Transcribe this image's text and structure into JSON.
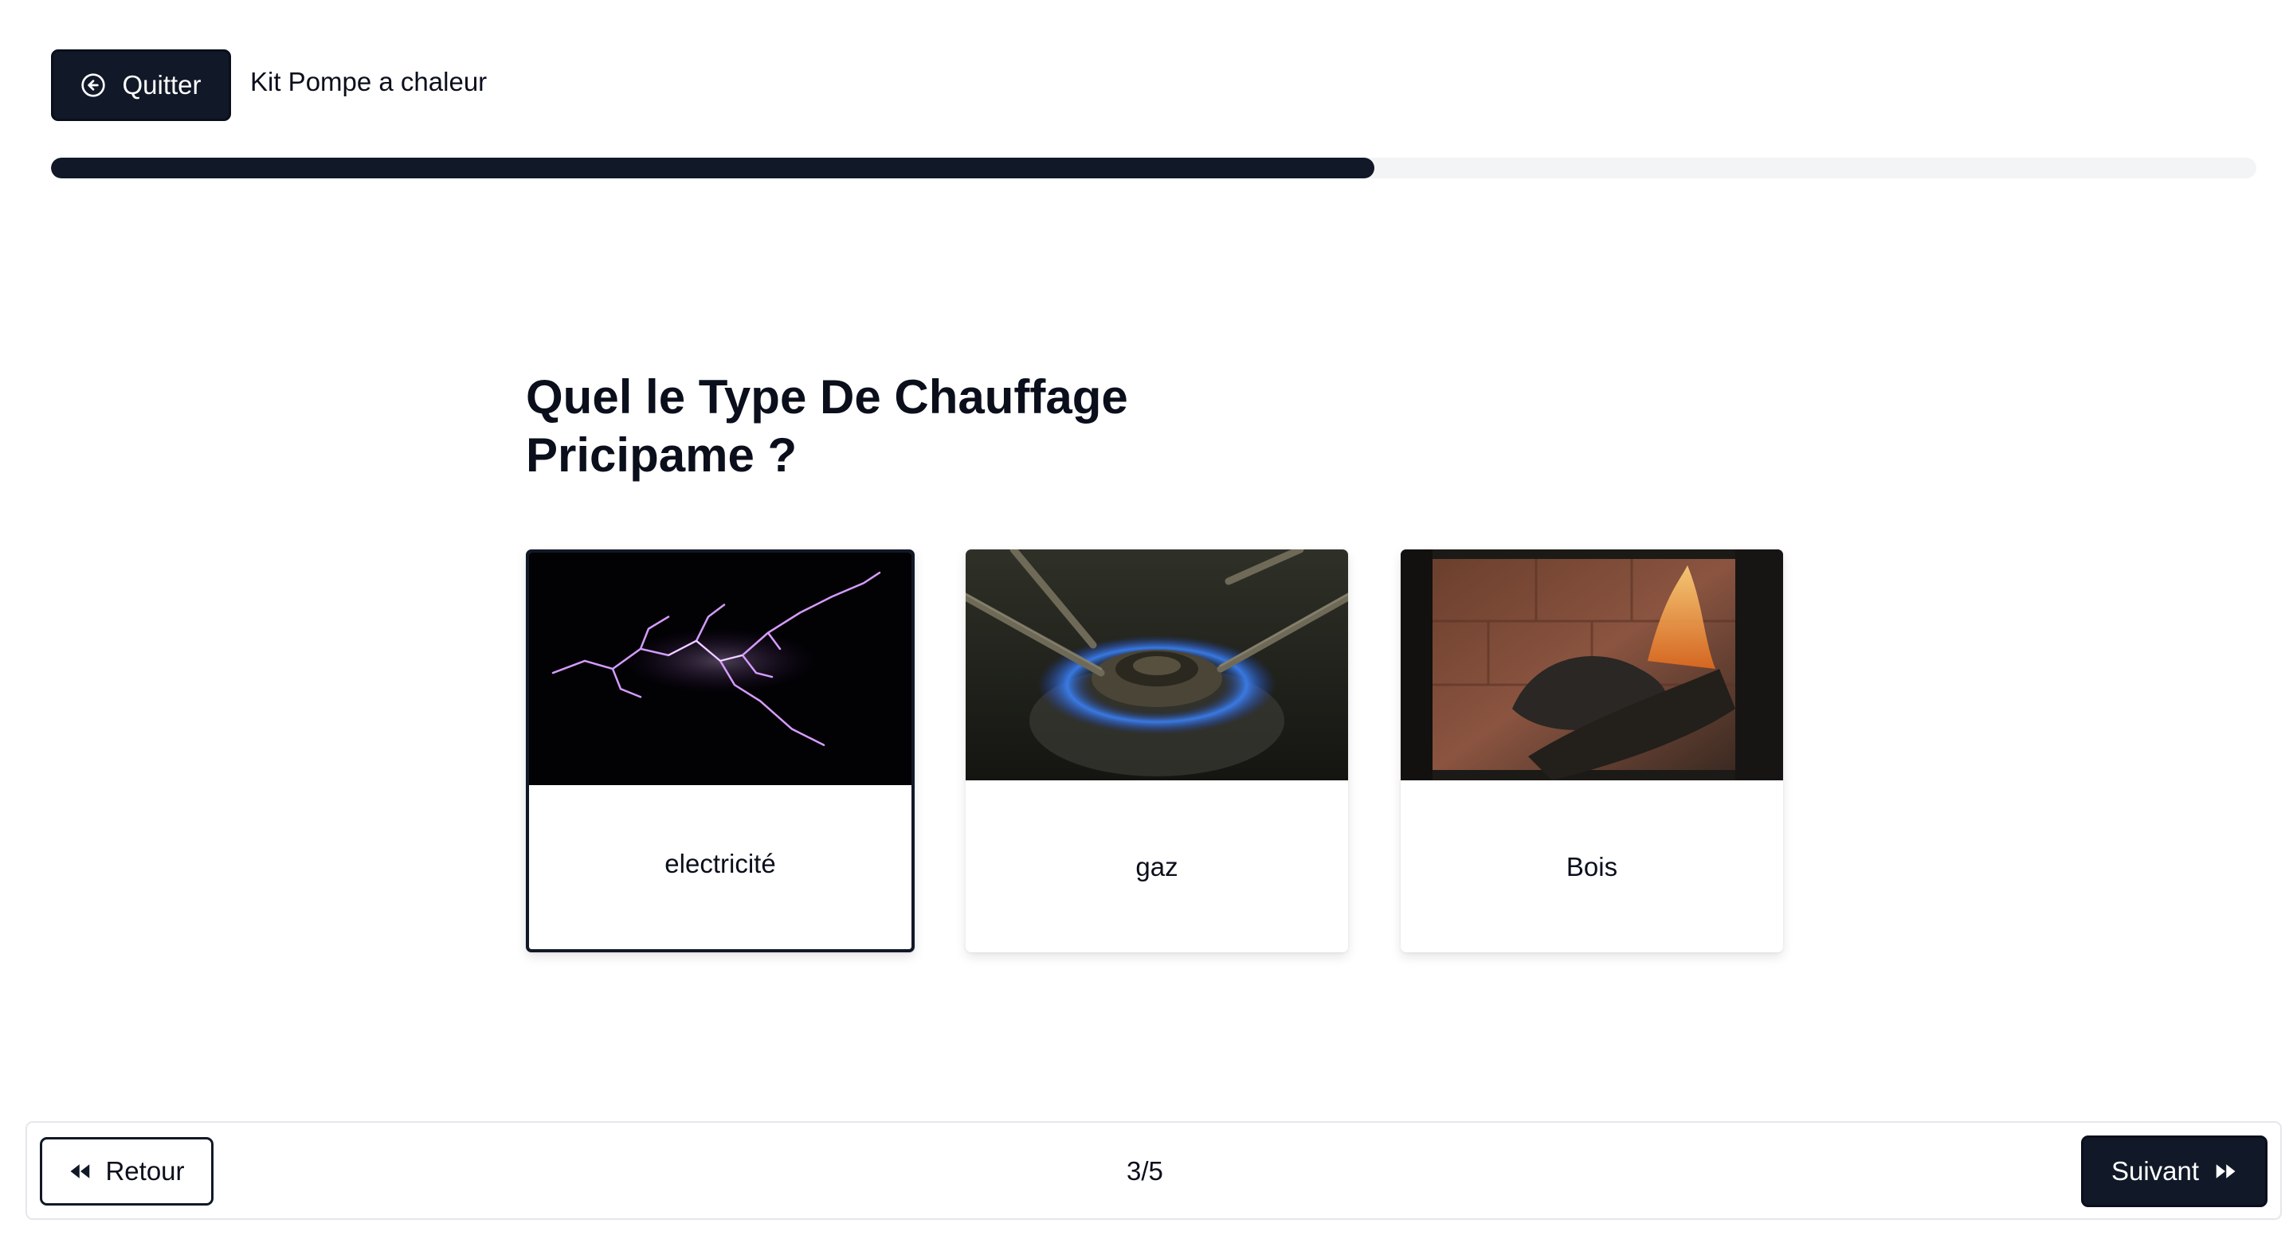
{
  "header": {
    "quit_label": "Quitter",
    "kit_title": "Kit Pompe a chaleur"
  },
  "progress": {
    "fraction": 0.6,
    "color": "#111827",
    "track_color": "#f3f4f6"
  },
  "question": {
    "text": "Quel le Type De Chauffage Pricipame ?"
  },
  "options": [
    {
      "label": "electricité",
      "icon": "lightning-photo",
      "selected": true
    },
    {
      "label": "gaz",
      "icon": "gas-flame-photo",
      "selected": false
    },
    {
      "label": "Bois",
      "icon": "wood-fire-photo",
      "selected": false
    }
  ],
  "footer": {
    "back_label": "Retour",
    "page_indicator": "3/5",
    "next_label": "Suivant"
  },
  "colors": {
    "primary": "#111827",
    "text": "#0b0f1c",
    "border": "#e5e7eb"
  }
}
